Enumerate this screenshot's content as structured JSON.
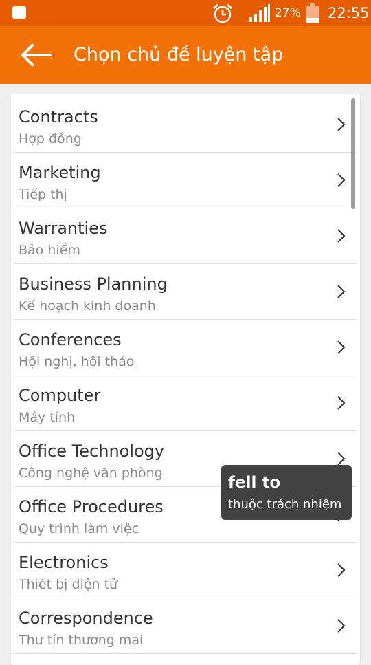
{
  "status_bar": {
    "battery_percent": "27%",
    "time": "22:55",
    "icons": [
      "notification-icon",
      "alarm-icon",
      "signal-icon",
      "battery-icon"
    ]
  },
  "app_bar": {
    "title": "Chọn chủ đề luyện tập",
    "back_icon": "arrow-back-icon"
  },
  "topics": [
    {
      "title": "Contracts",
      "subtitle": "Hợp đồng"
    },
    {
      "title": "Marketing",
      "subtitle": "Tiếp thị"
    },
    {
      "title": "Warranties",
      "subtitle": "Bảo hiểm"
    },
    {
      "title": "Business Planning",
      "subtitle": "Kế hoạch kinh doanh"
    },
    {
      "title": "Conferences",
      "subtitle": "Hội nghị, hội thảo"
    },
    {
      "title": "Computer",
      "subtitle": "Máy tính"
    },
    {
      "title": "Office Technology",
      "subtitle": "Công nghệ văn phòng"
    },
    {
      "title": "Office Procedures",
      "subtitle": "Quy trình làm việc"
    },
    {
      "title": "Electronics",
      "subtitle": "Thiết bị điện tử"
    },
    {
      "title": "Correspondence",
      "subtitle": "Thư tín thương mại"
    }
  ],
  "tooltip": {
    "word": "fell to",
    "meaning": "thuộc trách nhiệm"
  },
  "colors": {
    "status_bar": "#e65c00",
    "app_bar": "#f27208",
    "background": "#eeeeee",
    "tooltip": "#424242"
  }
}
